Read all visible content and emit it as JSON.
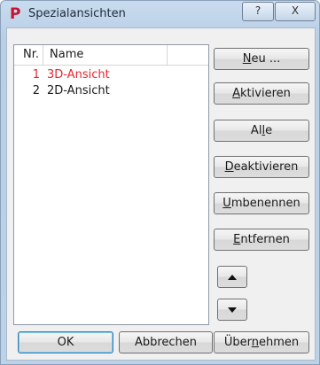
{
  "window": {
    "title": "Spezialansichten",
    "logo_letter": "P",
    "help_label": "?",
    "close_label": "X"
  },
  "list": {
    "columns": {
      "nr": "Nr.",
      "name": "Name"
    },
    "rows": [
      {
        "nr": "1",
        "name": "3D-Ansicht",
        "active": true
      },
      {
        "nr": "2",
        "name": "2D-Ansicht",
        "active": false
      }
    ]
  },
  "buttons": {
    "new": {
      "pre": "",
      "ul": "N",
      "post": "eu ..."
    },
    "activate": {
      "pre": "",
      "ul": "A",
      "post": "ktivieren"
    },
    "all": {
      "pre": "Al",
      "ul": "l",
      "post": "e"
    },
    "deactivate": {
      "pre": "",
      "ul": "D",
      "post": "eaktivieren"
    },
    "rename": {
      "pre": "",
      "ul": "U",
      "post": "mbenennen"
    },
    "remove": {
      "pre": "",
      "ul": "E",
      "post": "ntfernen"
    },
    "ok": "OK",
    "cancel": "Abbrechen",
    "apply": {
      "pre": "Über",
      "ul": "n",
      "post": "ehmen"
    }
  },
  "icons": {
    "move_up": "arrow-up-icon",
    "move_down": "arrow-down-icon"
  },
  "colors": {
    "active_item": "#e8262b",
    "logo": "#c8102e"
  }
}
